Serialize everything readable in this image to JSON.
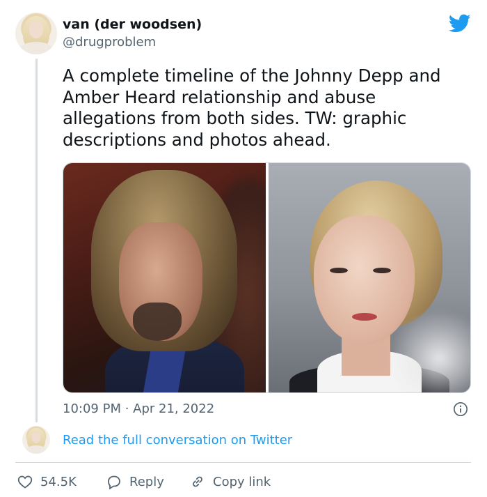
{
  "author": {
    "display_name": "van (der woodsen)",
    "handle": "@drugproblem"
  },
  "tweet": {
    "text": "A complete timeline of the Johnny Depp and Amber Heard relationship and abuse allegations from both sides. TW: graphic descriptions and photos ahead.",
    "timestamp": "10:09 PM · Apr 21, 2022"
  },
  "media": {
    "count": 2
  },
  "conversation": {
    "link_label": "Read the full conversation on Twitter"
  },
  "actions": {
    "likes": "54.5K",
    "reply_label": "Reply",
    "copy_link_label": "Copy link"
  },
  "icons": {
    "brand": "twitter-bird-icon",
    "info": "info-icon",
    "like": "heart-icon",
    "reply": "comment-bubble-icon",
    "copy_link": "link-icon"
  },
  "colors": {
    "twitter_blue": "#1d9bf0",
    "secondary_text": "#536471",
    "primary_text": "#0f1419",
    "border": "#cfd9de"
  }
}
